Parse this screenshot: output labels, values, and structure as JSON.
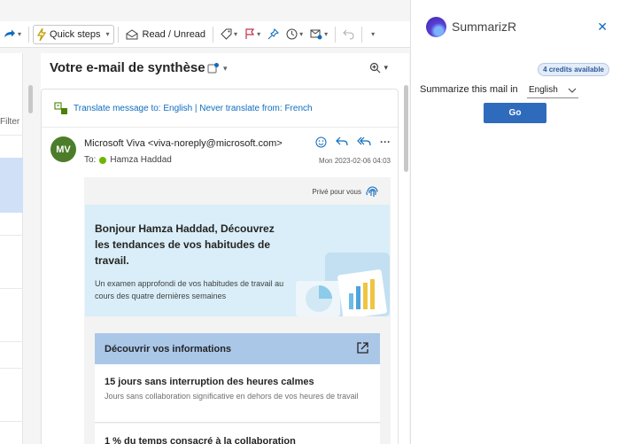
{
  "toolbar": {
    "quick_steps": "Quick steps",
    "read_unread": "Read / Unread"
  },
  "list": {
    "filter_label": "Filter"
  },
  "message": {
    "subject": "Votre e-mail de synthèse",
    "translate_text": "Translate message to: English | Never translate from: French",
    "avatar_initials": "MV",
    "sender": "Microsoft Viva <viva-noreply@microsoft.com>",
    "to_label": "To:",
    "recipient": "Hamza Haddad",
    "date": "Mon 2023-02-06 04:03",
    "body": {
      "private_label": "Privé pour vous",
      "hero_title": "Bonjour Hamza Haddad, Découvrez les tendances de vos habitudes de travail.",
      "hero_subtitle": "Un examen approfondi de vos habitudes de travail au cours des quatre dernières semaines",
      "discover_label": "Découvrir vos informations",
      "items": [
        {
          "title": "15 jours sans interruption des heures calmes",
          "subtitle": "Jours sans collaboration significative en dehors de vos heures de travail"
        },
        {
          "title": "1 % du temps consacré à la collaboration",
          "subtitle": ""
        }
      ]
    }
  },
  "addin": {
    "name": "SummarizR",
    "credits_badge": "4 credits available",
    "summarize_label": "Summarize this mail in",
    "language": "English",
    "go_label": "Go"
  },
  "colors": {
    "accent": "#0f6cbd",
    "go_button": "#2f6bbd",
    "avatar": "#4c7d2a",
    "hero_bg": "#d9eef8",
    "discover_bg": "#aac7e8"
  }
}
